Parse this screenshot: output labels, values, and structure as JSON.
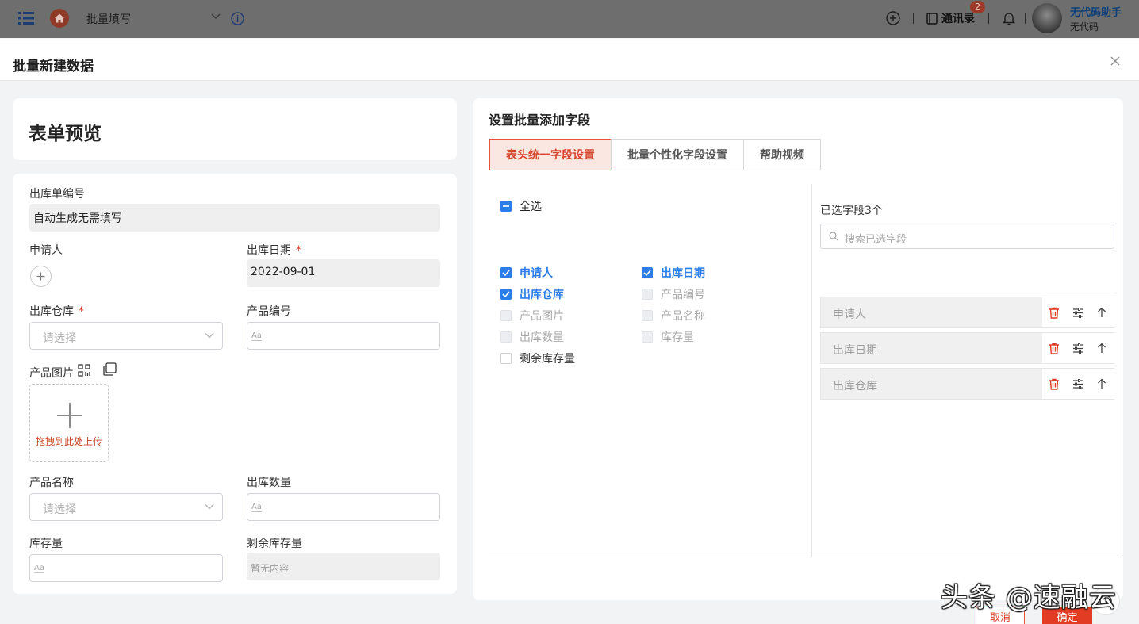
{
  "topbar": {
    "title": "批量填写",
    "contacts_label": "通讯录",
    "contacts_badge": "2",
    "user_name": "无代码助手",
    "user_org": "无代码"
  },
  "modal": {
    "title": "批量新建数据"
  },
  "preview": {
    "title": "表单预览",
    "fields": {
      "order_no": {
        "label": "出库单编号",
        "value": "自动生成无需填写"
      },
      "applicant": {
        "label": "申请人"
      },
      "out_date": {
        "label": "出库日期",
        "required": "*",
        "value": "2022-09-01"
      },
      "warehouse": {
        "label": "出库仓库",
        "required": "*",
        "placeholder": "请选择"
      },
      "product_code": {
        "label": "产品编号",
        "hint": "Aa"
      },
      "product_image": {
        "label": "产品图片",
        "upload_text": "拖拽到此处上传"
      },
      "product_name": {
        "label": "产品名称",
        "placeholder": "请选择"
      },
      "out_qty": {
        "label": "出库数量",
        "hint": "Aa"
      },
      "stock": {
        "label": "库存量",
        "hint": "Aa"
      },
      "remaining_stock": {
        "label": "剩余库存量",
        "value": "暂无内容"
      }
    }
  },
  "config": {
    "title": "设置批量添加字段",
    "tabs": [
      {
        "label": "表头统一字段设置",
        "active": true
      },
      {
        "label": "批量个性化字段设置",
        "active": false
      },
      {
        "label": "帮助视频",
        "active": false
      }
    ],
    "select_all": "全选",
    "fields": [
      {
        "label": "申请人",
        "state": "checked"
      },
      {
        "label": "出库日期",
        "state": "checked"
      },
      {
        "label": "出库仓库",
        "state": "checked"
      },
      {
        "label": "产品编号",
        "state": "disabled"
      },
      {
        "label": "产品图片",
        "state": "disabled"
      },
      {
        "label": "产品名称",
        "state": "disabled"
      },
      {
        "label": "出库数量",
        "state": "disabled"
      },
      {
        "label": "库存量",
        "state": "disabled"
      },
      {
        "label": "剩余库存量",
        "state": "unchecked"
      }
    ],
    "selected_title": "已选字段3个",
    "search_placeholder": "搜索已选字段",
    "selected": [
      "申请人",
      "出库日期",
      "出库仓库"
    ],
    "cancel_label": "取消",
    "ok_label": "确定"
  },
  "colors": {
    "accent": "#e23c24",
    "checkbox_blue": "#2b7de9",
    "active_tab_bg": "#fbe7e2"
  },
  "watermark": "头条 @速融云"
}
